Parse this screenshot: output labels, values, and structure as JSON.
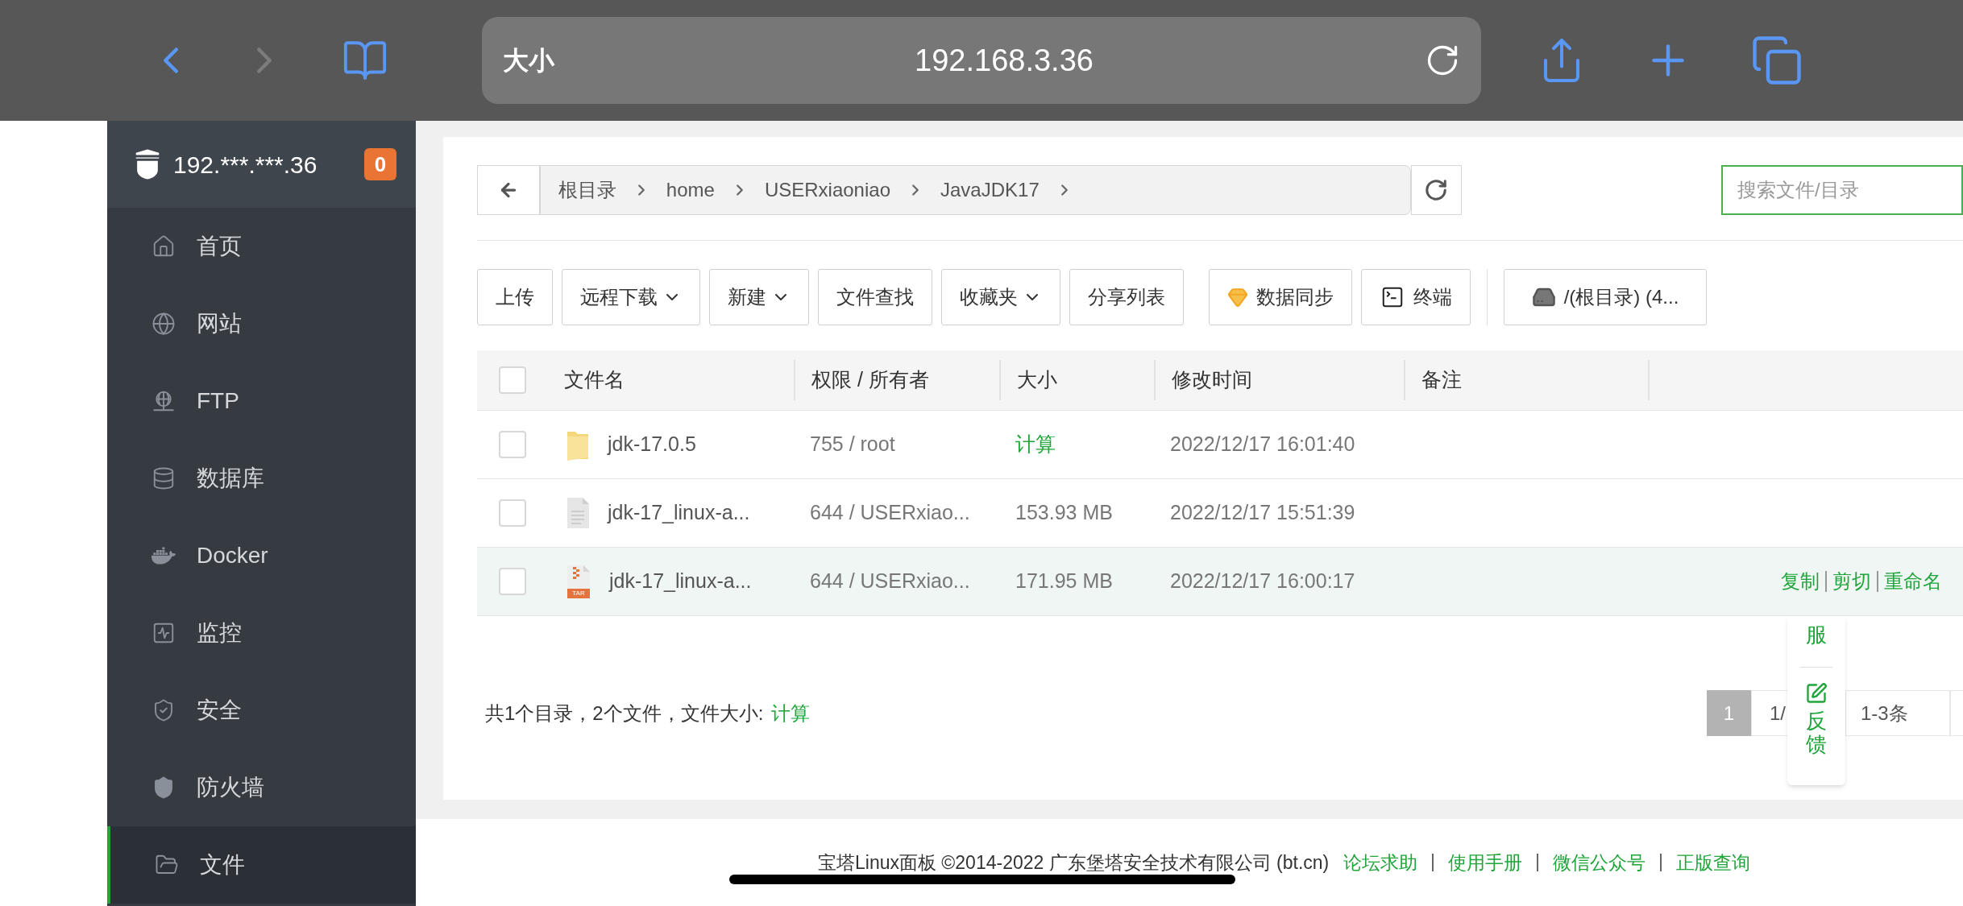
{
  "browser": {
    "text_size": "大小",
    "url": "192.168.3.36"
  },
  "sidebar": {
    "host": "192.***.***.36",
    "badge": "0",
    "items": [
      {
        "label": "首页",
        "kind": "home",
        "selected": false
      },
      {
        "label": "网站",
        "kind": "globe",
        "selected": false
      },
      {
        "label": "FTP",
        "kind": "ftp",
        "selected": false
      },
      {
        "label": "数据库",
        "kind": "database",
        "selected": false
      },
      {
        "label": "Docker",
        "kind": "docker",
        "selected": false
      },
      {
        "label": "监控",
        "kind": "monitor",
        "selected": false
      },
      {
        "label": "安全",
        "kind": "security",
        "selected": false
      },
      {
        "label": "防火墙",
        "kind": "firewall",
        "selected": false
      },
      {
        "label": "文件",
        "kind": "files",
        "selected": true
      }
    ]
  },
  "breadcrumb": [
    "根目录",
    "home",
    "USERxiaoniao",
    "JavaJDK17"
  ],
  "search": {
    "placeholder": "搜索文件/目录"
  },
  "toolbar": [
    {
      "label": "上传",
      "kind": "plain"
    },
    {
      "label": "远程下载",
      "kind": "dropdown"
    },
    {
      "label": "新建",
      "kind": "dropdown"
    },
    {
      "label": "文件查找",
      "kind": "plain"
    },
    {
      "label": "收藏夹",
      "kind": "dropdown"
    },
    {
      "label": "分享列表",
      "kind": "plain"
    },
    {
      "label": "数据同步",
      "kind": "sync"
    },
    {
      "label": "终端",
      "kind": "terminal"
    },
    {
      "label": "/(根目录) (4...",
      "kind": "disk"
    }
  ],
  "table": {
    "checked": false,
    "columns": [
      "文件名",
      "权限 / 所有者",
      "大小",
      "修改时间",
      "备注"
    ],
    "rows": [
      {
        "kind": "folder",
        "name": "jdk-17.0.5",
        "owner": "755 / root",
        "size": "计算",
        "size_is_link": true,
        "modified": "2022/12/17 16:01:40",
        "checked": false,
        "selected": false
      },
      {
        "kind": "file",
        "name": "jdk-17_linux-a...",
        "owner": "644 / USERxiao...",
        "size": "153.93 MB",
        "size_is_link": false,
        "modified": "2022/12/17 15:51:39",
        "checked": false,
        "selected": false
      },
      {
        "kind": "tar",
        "icon_label": "TAR",
        "name": "jdk-17_linux-a...",
        "owner": "644 / USERxiao...",
        "size": "171.95 MB",
        "size_is_link": false,
        "modified": "2022/12/17 16:00:17",
        "checked": false,
        "selected": true,
        "actions": [
          "复制",
          "剪切",
          "重命名"
        ]
      }
    ]
  },
  "summary": {
    "text": "共1个目录，2个文件，文件大小:",
    "link": "计算"
  },
  "pagination": [
    {
      "label": "1",
      "kind": "page",
      "selected": true
    },
    {
      "label": "1/",
      "kind": "info",
      "selected": false
    },
    {
      "label": "1-3条",
      "kind": "info",
      "selected": false
    }
  ],
  "float_panel": {
    "service": "服",
    "feedback": "反馈"
  },
  "footer": {
    "copyright": "宝塔Linux面板 ©2014-2022 广东堡塔安全技术有限公司 (bt.cn)",
    "links": [
      "论坛求助",
      "使用手册",
      "微信公众号",
      "正版查询"
    ]
  }
}
